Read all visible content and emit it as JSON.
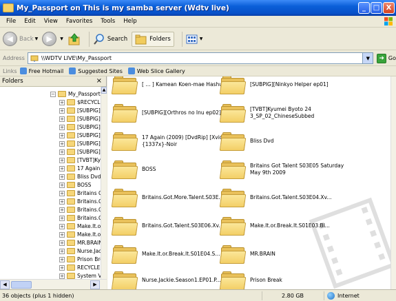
{
  "window": {
    "title": "My_Passport on This is my samba server (Wdtv live)",
    "buttons": [
      "_",
      "□",
      "X"
    ]
  },
  "menu": [
    "File",
    "Edit",
    "View",
    "Favorites",
    "Tools",
    "Help"
  ],
  "toolbar": {
    "back": "Back",
    "search": "Search",
    "folders": "Folders"
  },
  "address": {
    "label": "Address",
    "value": "\\\\WDTV LIVE\\My_Passport",
    "go": "Go"
  },
  "links": {
    "label": "Links",
    "items": [
      "Free Hotmail",
      "Suggested Sites",
      "Web Slice Gallery"
    ]
  },
  "folders_pane": {
    "title": "Folders",
    "close": "×",
    "tree": [
      "My_Passport",
      "$RECYCLE",
      "[SUBPIG]",
      "[SUBPIG]",
      "[SUBPIG]",
      "[SUBPIG]",
      "[SUBPIG]",
      "[SUBPIG]",
      "[TVBT]Ky",
      "17 Again",
      "Bliss Dvd",
      "BOSS",
      "Britains G",
      "Britains.G",
      "Britains.G",
      "Britains.G",
      "Make.It.o",
      "Make.It.o",
      "MR.BRAIN",
      "Nurse.Jac",
      "Prison Bre",
      "RECYCLER",
      "System V"
    ]
  },
  "files": [
    {
      "name": "[ ... ] Kamean Koen-mae Hashutsuj..."
    },
    {
      "name": "[SUBPIG][Ninkyo Helper ep01]"
    },
    {
      "name": "[SUBPIG][Orthros no Inu ep02]"
    },
    {
      "name": "[TVBT]Kyumei Byoto 24 3_SP_02_ChineseSubbed"
    },
    {
      "name": "17 Again (2009) [DvdRip] [Xvid] {1337x}-Noir"
    },
    {
      "name": "Bliss Dvd"
    },
    {
      "name": "BOSS"
    },
    {
      "name": "Britains Got Talent S03E05 Saturday May 9th 2009"
    },
    {
      "name": "Britains.Got.More.Talent.S03E..."
    },
    {
      "name": "Britains.Got.Talent.S03E04.Xv..."
    },
    {
      "name": "Britains.Got.Talent.S03E06.Xv..."
    },
    {
      "name": "Make.It.or.Break.It.S01E03.Bl..."
    },
    {
      "name": "Make.It.or.Break.It.S01E04.S..."
    },
    {
      "name": "MR.BRAIN"
    },
    {
      "name": "Nurse.Jackie.Season1.EP01.P..."
    },
    {
      "name": "Prison Break"
    }
  ],
  "status": {
    "objects": "36 objects (plus 1 hidden)",
    "size": "2.80 GB",
    "zone": "Internet"
  }
}
